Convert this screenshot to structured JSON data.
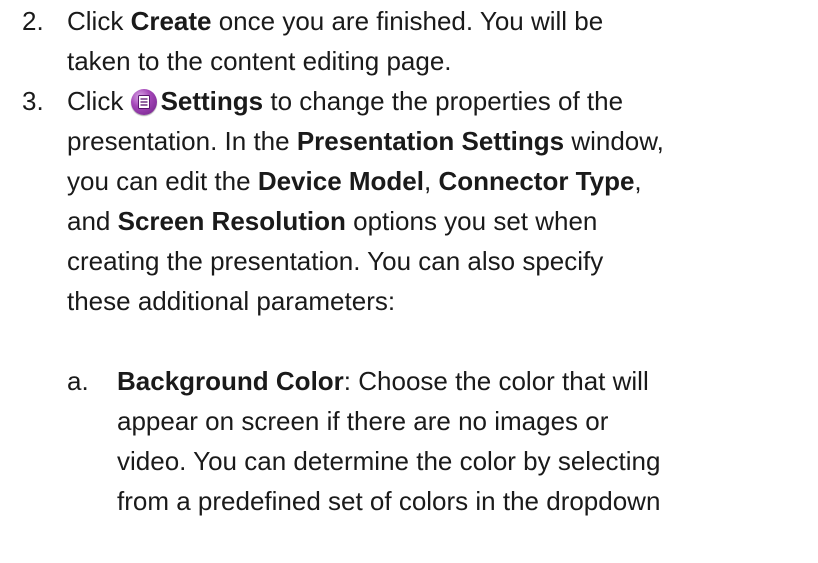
{
  "step2": {
    "number": "2.",
    "l1_a": "Click ",
    "l1_b": "Create",
    "l1_c": " once you are finished. You will be",
    "l2": "taken to the content editing page."
  },
  "step3": {
    "number": "3.",
    "l1_a": "Click ",
    "icon": "settings-icon",
    "l1_b": "Settings",
    "l1_c": " to change the properties of the",
    "l2_a": "presentation. In the ",
    "l2_b": "Presentation Settings",
    "l2_c": " window,",
    "l3_a": "you can edit the ",
    "l3_b": "Device Model",
    "l3_c": ", ",
    "l3_d": "Connector Type",
    "l3_e": ",",
    "l4_a": "and ",
    "l4_b": "Screen Resolution",
    "l4_c": " options you set when",
    "l5": "creating the presentation. You can also specify",
    "l6": "these additional parameters:"
  },
  "substep_a": {
    "letter": "a.",
    "l1_b": "Background Color",
    "l1_c": ": Choose the color that will",
    "l2": "appear on screen if there are no images or",
    "l3": "video. You can determine the color by selecting",
    "l4": "from a predefined set of colors in the dropdown"
  },
  "colors": {
    "text": "#1a1a1a",
    "icon": "#a447b8"
  }
}
